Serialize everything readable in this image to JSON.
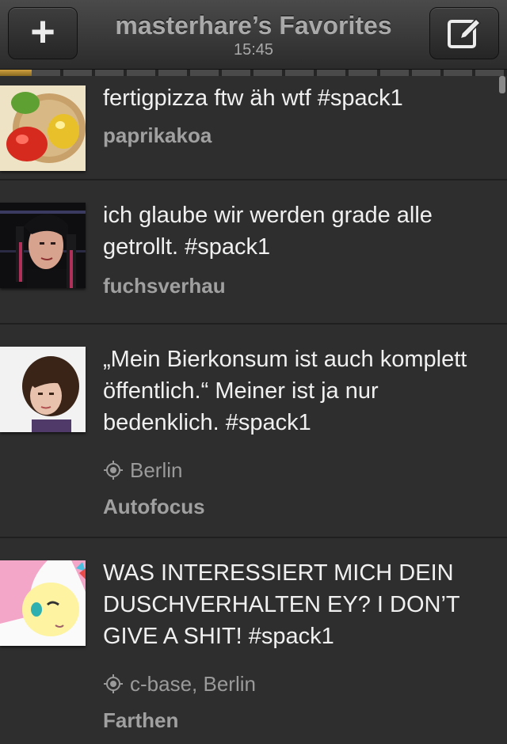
{
  "navbar": {
    "title": "masterhare’s Favorites",
    "time": "15:45",
    "left_icon": "plus-icon",
    "right_icon": "compose-icon"
  },
  "tweets": [
    {
      "text": "fertigpizza ftw äh wtf #spack1",
      "location": "",
      "author": "paprikakoa"
    },
    {
      "text": "ich glaube wir werden grade alle getrollt. #spack1",
      "location": "",
      "author": "fuchsverhau"
    },
    {
      "text": "„Mein Bierkonsum ist auch komplett öffentlich.“ Meiner ist ja nur bedenklich. #spack1",
      "location": "Berlin",
      "author": "Autofocus"
    },
    {
      "text": "WAS INTERESSIERT MICH DEIN DUSCHVERHALTEN EY? I DON’T GIVE A SHIT! #spack1",
      "location": "c-base, Berlin",
      "author": "Farthen"
    }
  ]
}
